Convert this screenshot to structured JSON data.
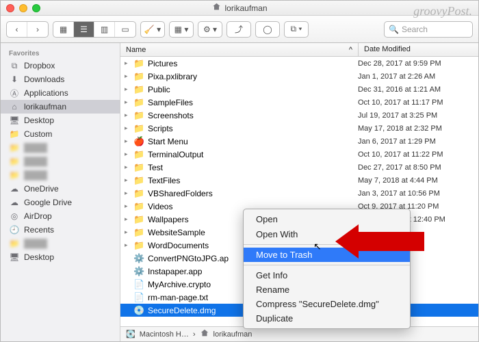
{
  "watermark": "groovyPost.",
  "window": {
    "title": "lorikaufman"
  },
  "toolbar": {
    "search_placeholder": "Search"
  },
  "sidebar": {
    "header": "Favorites",
    "items": [
      {
        "label": "Dropbox",
        "icon": "dropbox"
      },
      {
        "label": "Downloads",
        "icon": "downloads"
      },
      {
        "label": "Applications",
        "icon": "apps"
      },
      {
        "label": "lorikaufman",
        "icon": "home",
        "selected": true
      },
      {
        "label": "Desktop",
        "icon": "desktop"
      },
      {
        "label": "Custom",
        "icon": "folder"
      },
      {
        "label": "",
        "icon": "folder",
        "blur": true
      },
      {
        "label": "",
        "icon": "folder",
        "blur": true
      },
      {
        "label": "",
        "icon": "folder",
        "blur": true
      },
      {
        "label": "OneDrive",
        "icon": "cloud"
      },
      {
        "label": "Google Drive",
        "icon": "cloud"
      },
      {
        "label": "AirDrop",
        "icon": "airdrop"
      },
      {
        "label": "Recents",
        "icon": "recents"
      },
      {
        "label": "",
        "icon": "folder",
        "blur": true
      },
      {
        "label": "Desktop",
        "icon": "desktop"
      }
    ]
  },
  "columns": {
    "name": "Name",
    "date": "Date Modified",
    "sort_asc": "^"
  },
  "files": [
    {
      "name": "Pictures",
      "type": "folder",
      "date": "Dec 28, 2017 at 9:59 PM"
    },
    {
      "name": "Pixa.pxlibrary",
      "type": "folder",
      "date": "Jan 1, 2017 at 2:26 AM"
    },
    {
      "name": "Public",
      "type": "folder",
      "date": "Dec 31, 2016 at 1:21 AM"
    },
    {
      "name": "SampleFiles",
      "type": "folder",
      "date": "Oct 10, 2017 at 11:17 PM"
    },
    {
      "name": "Screenshots",
      "type": "folder",
      "date": "Jul 19, 2017 at 3:25 PM"
    },
    {
      "name": "Scripts",
      "type": "folder",
      "date": "May 17, 2018 at 2:32 PM"
    },
    {
      "name": "Start Menu",
      "type": "apple",
      "date": "Jan 6, 2017 at 1:29 PM"
    },
    {
      "name": "TerminalOutput",
      "type": "folder",
      "date": "Oct 10, 2017 at 11:22 PM"
    },
    {
      "name": "Test",
      "type": "folder",
      "date": "Dec 27, 2017 at 8:50 PM"
    },
    {
      "name": "TextFiles",
      "type": "folder",
      "date": "May 7, 2018 at 4:44 PM"
    },
    {
      "name": "VBSharedFolders",
      "type": "folder",
      "date": "Jan 3, 2017 at 10:56 PM"
    },
    {
      "name": "Videos",
      "type": "folder",
      "date": "Oct 9, 2017 at 11:20 PM"
    },
    {
      "name": "Wallpapers",
      "type": "folder",
      "date": "Aug 29, 2017 at 12:40 PM"
    },
    {
      "name": "WebsiteSample",
      "type": "folder",
      "date": "17 at 10:39 PM"
    },
    {
      "name": "WordDocuments",
      "type": "folder",
      "date": "17 at 10:58 PM"
    },
    {
      "name": "ConvertPNGtoJPG.ap",
      "type": "app",
      "date": "17 at 6:59 PM"
    },
    {
      "name": "Instapaper.app",
      "type": "app",
      "date": "17 at 8:40 PM"
    },
    {
      "name": "MyArchive.crypto",
      "type": "doc",
      "date": "17 at 8:23 PM"
    },
    {
      "name": "rm-man-page.txt",
      "type": "doc",
      "date": "2:59 PM"
    },
    {
      "name": "SecureDelete.dmg",
      "type": "dmg",
      "date": "3:34 PM",
      "selected": true
    }
  ],
  "context_menu": {
    "groups": [
      [
        {
          "label": "Open"
        },
        {
          "label": "Open With",
          "submenu": true
        }
      ],
      [
        {
          "label": "Move to Trash",
          "highlighted": true
        }
      ],
      [
        {
          "label": "Get Info"
        },
        {
          "label": "Rename"
        },
        {
          "label": "Compress \"SecureDelete.dmg\""
        },
        {
          "label": "Duplicate"
        }
      ]
    ]
  },
  "pathbar": {
    "items": [
      "Macintosh H…",
      "lorikaufman"
    ],
    "sep": "›"
  }
}
